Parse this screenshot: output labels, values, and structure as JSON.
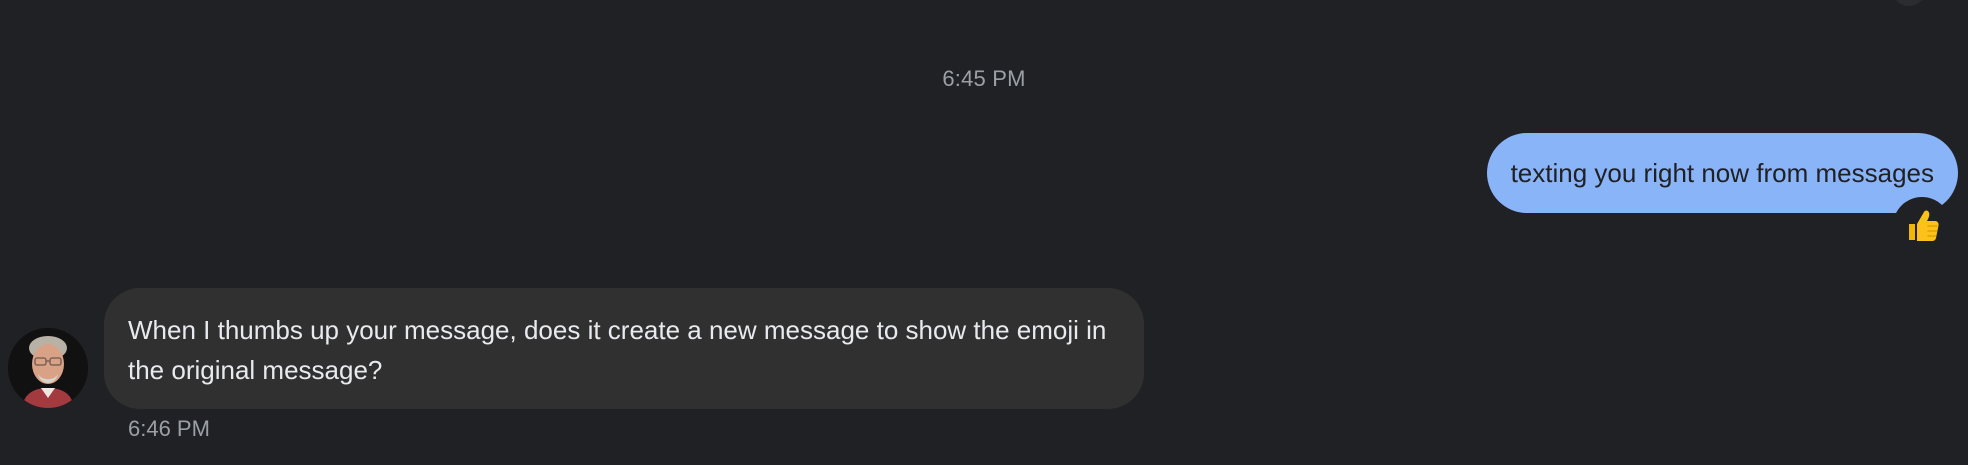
{
  "thread": {
    "divider_time": "6:45 PM",
    "messages": [
      {
        "direction": "outgoing",
        "text": "texting you right now from messages",
        "reaction": {
          "emoji": "👍",
          "icon": "thumbs-up-icon"
        }
      },
      {
        "direction": "incoming",
        "text": "When I thumbs up your message, does it create a new message to show the emoji in the original message?",
        "time": "6:46 PM",
        "avatar": "contact-avatar-photo"
      }
    ]
  },
  "colors": {
    "background": "#202124",
    "outgoing_bubble": "#8ab4f8",
    "incoming_bubble": "#303030",
    "muted_text": "#9aa0a6",
    "incoming_text": "#e8eaed"
  }
}
